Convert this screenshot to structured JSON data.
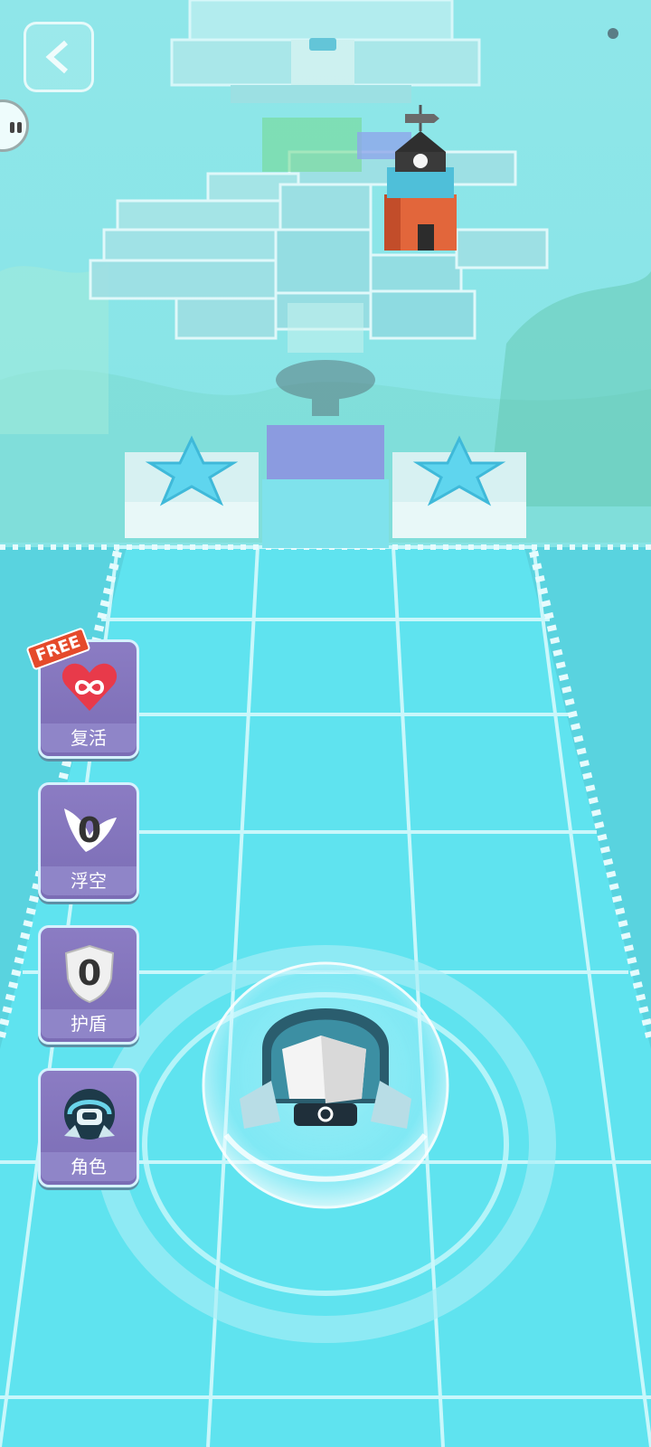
{
  "items": [
    {
      "label": "复活",
      "badge": "FREE",
      "icon": "infinite-heart-icon"
    },
    {
      "label": "浮空",
      "count": "0",
      "icon": "wing-icon"
    },
    {
      "label": "护盾",
      "count": "0",
      "icon": "shield-icon"
    },
    {
      "label": "角色",
      "icon": "robot-head-icon"
    }
  ],
  "colors": {
    "sky": "#7fe0e8",
    "floor": "#5fe3ef",
    "panel": "#8b7cc3",
    "tower": "#e2663b"
  }
}
